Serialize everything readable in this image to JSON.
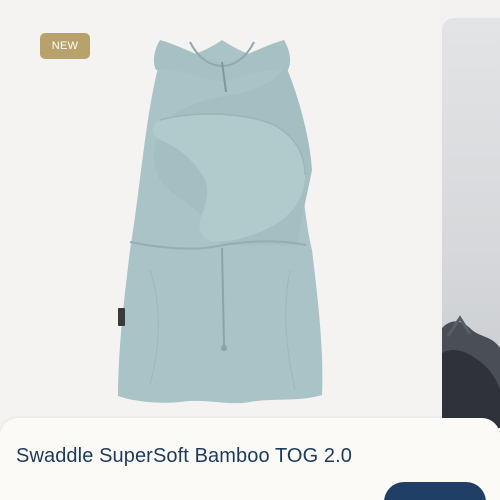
{
  "product": {
    "badge": "NEW",
    "title": "Swaddle SuperSoft Bamboo TOG 2.0",
    "colors": {
      "fabric": "#a9c3c6",
      "badge": "#b8a26b",
      "title": "#1d3b5e",
      "button": "#1f3f66"
    }
  },
  "icons": {
    "product_photo": "swaddle-sack-image",
    "next_photo": "carousel-next-image"
  }
}
